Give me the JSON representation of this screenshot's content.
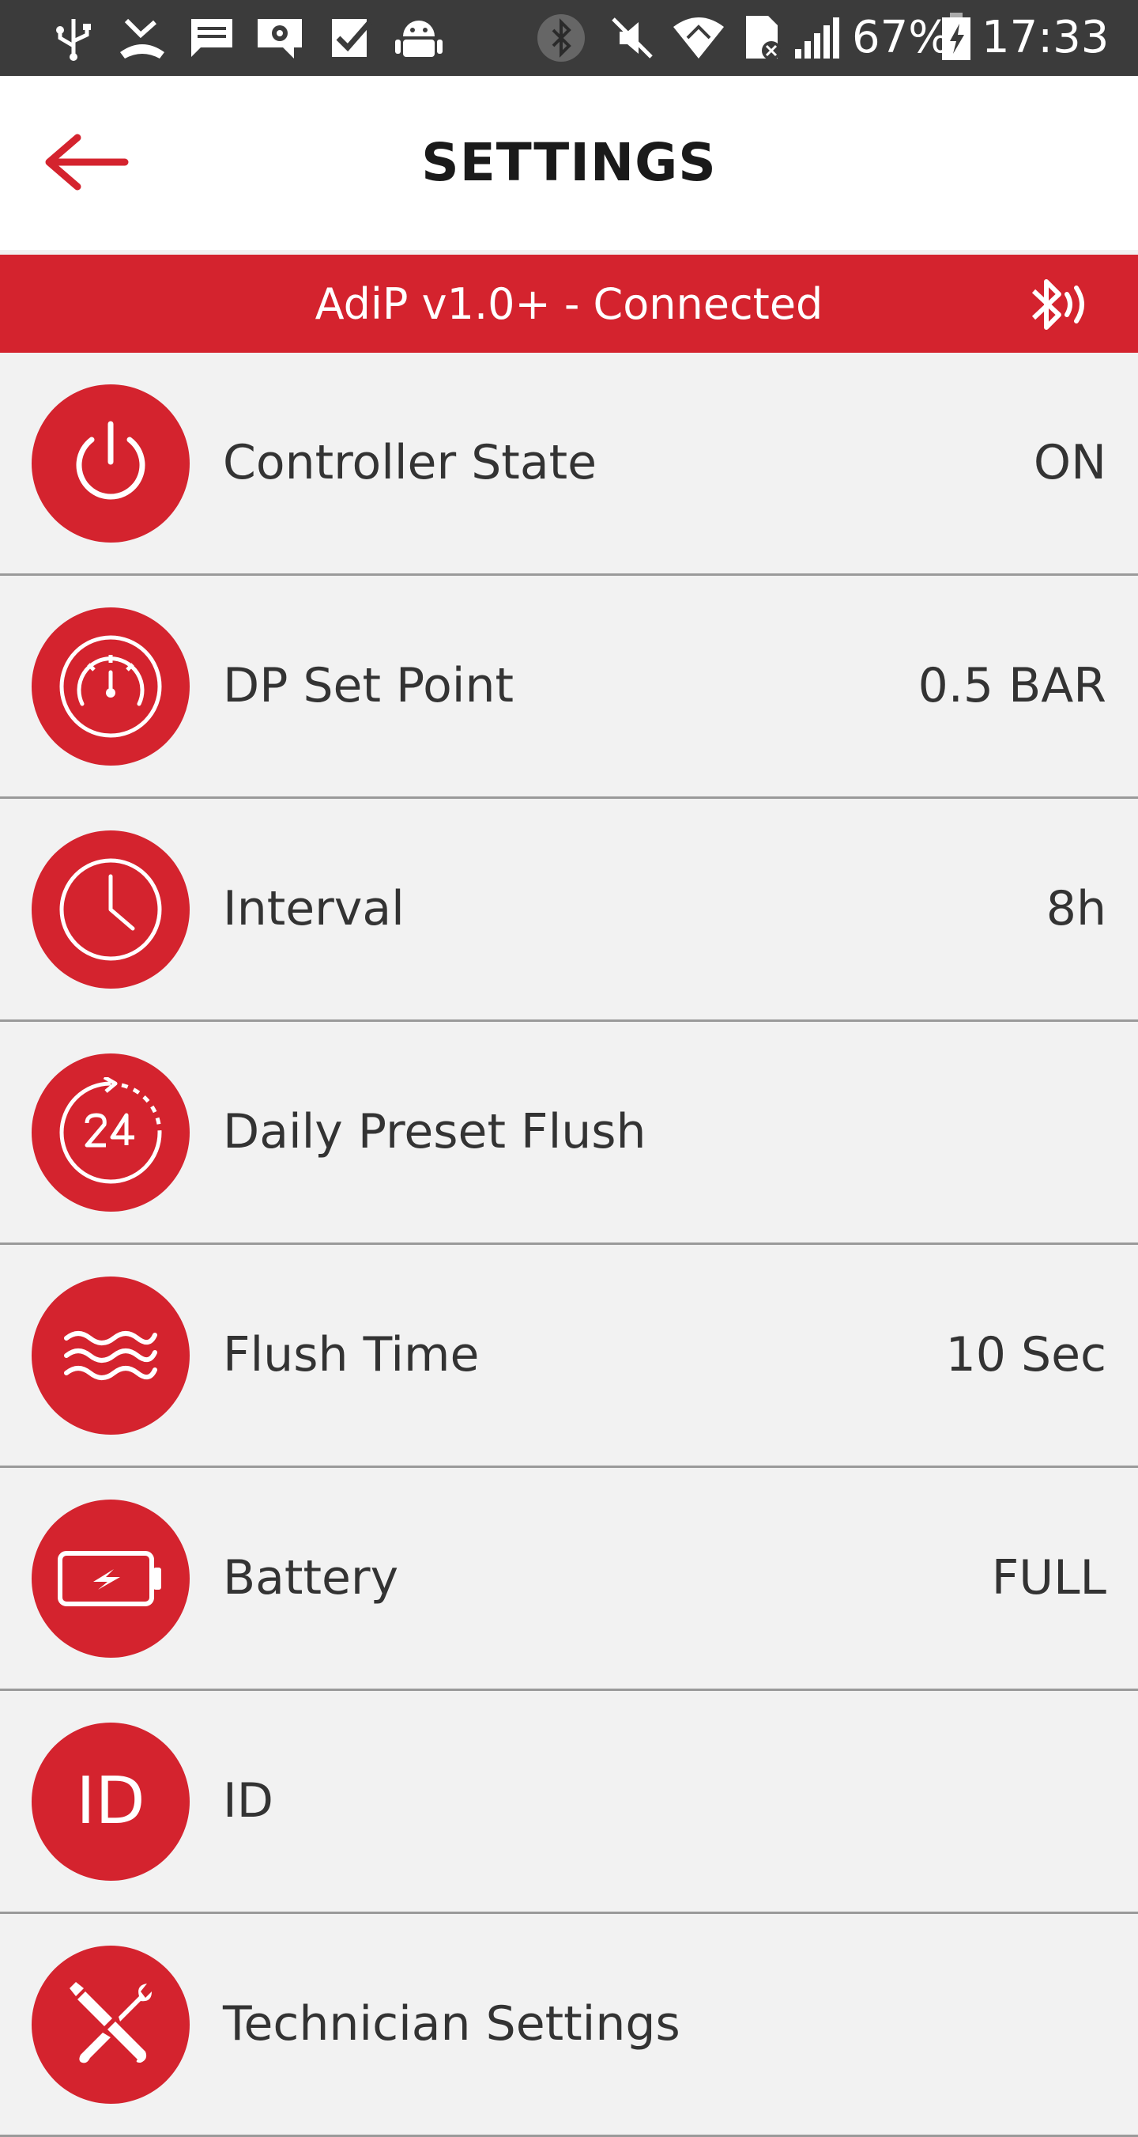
{
  "status_bar": {
    "battery_percent": "67%",
    "time": "17:33",
    "icons": [
      "usb-icon",
      "missed-call-icon",
      "message-icon",
      "settings-notification-icon",
      "task-icon",
      "android-icon",
      "bluetooth-icon",
      "mute-icon",
      "wifi-icon",
      "no-sim-icon",
      "signal-icon",
      "battery-charging-icon"
    ]
  },
  "header": {
    "title": "SETTINGS",
    "back_icon": "arrow-left-icon"
  },
  "connection": {
    "text": "AdiP v1.0+ - Connected",
    "icon": "bluetooth-signal-icon"
  },
  "settings": [
    {
      "label": "Controller State",
      "value": "ON",
      "icon": "power-icon"
    },
    {
      "label": "DP Set Point",
      "value": "0.5 BAR",
      "icon": "gauge-icon"
    },
    {
      "label": "Interval",
      "value": "8h",
      "icon": "clock-icon"
    },
    {
      "label": "Daily Preset Flush",
      "value": "",
      "icon": "timer-24-icon"
    },
    {
      "label": "Flush Time",
      "value": "10 Sec",
      "icon": "waves-icon"
    },
    {
      "label": "Battery",
      "value": "FULL",
      "icon": "battery-icon"
    },
    {
      "label": "ID",
      "value": "",
      "icon": "id-icon",
      "icon_text": "ID"
    },
    {
      "label": "Technician Settings",
      "value": "",
      "icon": "tools-icon"
    }
  ],
  "colors": {
    "accent": "#d4232e",
    "status_bar": "#3b3b3b",
    "list_background": "#f2f2f2",
    "divider": "#9a9a9a",
    "text": "#333333"
  }
}
